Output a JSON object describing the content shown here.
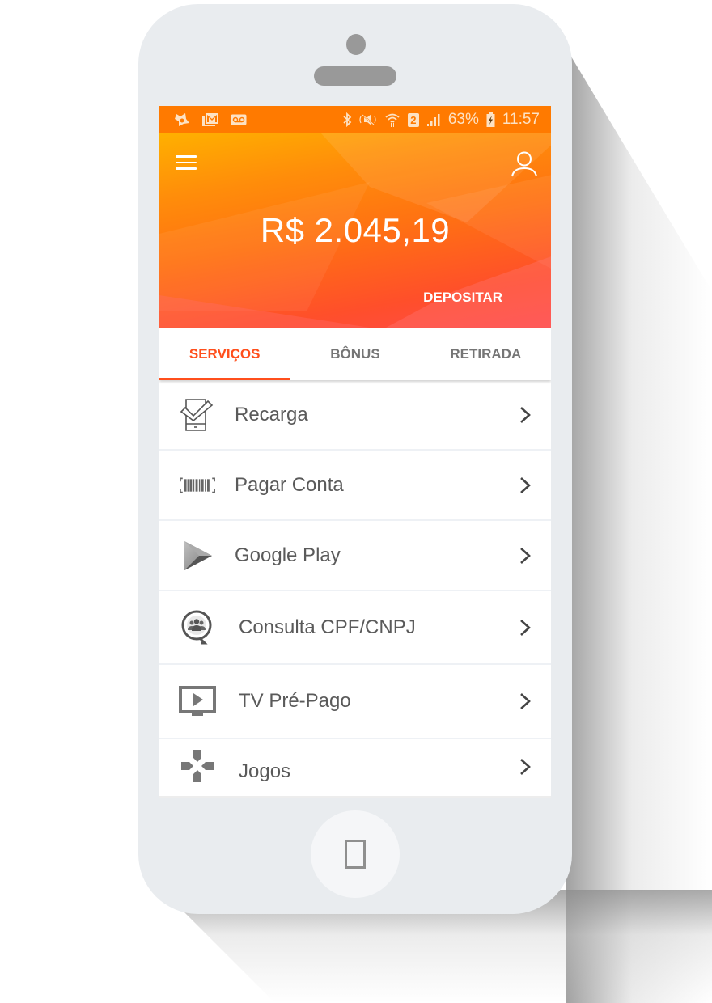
{
  "status_bar": {
    "left_icons": [
      "avast-icon",
      "gmail-icon",
      "voicemail-icon"
    ],
    "right_icons": [
      "bluetooth-icon",
      "mute-icon",
      "wifi-icon",
      "sim-icon",
      "signal-icon"
    ],
    "sim_slot": "2",
    "battery": "63%",
    "time": "11:57"
  },
  "header": {
    "balance": "R$ 2.045,19",
    "deposit_label": "DEPOSITAR"
  },
  "tabs": [
    {
      "label": "SERVIÇOS",
      "active": true
    },
    {
      "label": "BÔNUS",
      "active": false
    },
    {
      "label": "RETIRADA",
      "active": false
    }
  ],
  "services": [
    {
      "label": "Recarga",
      "icon": "phone-check-icon"
    },
    {
      "label": "Pagar Conta",
      "icon": "barcode-icon"
    },
    {
      "label": "Google Play",
      "icon": "google-play-icon"
    },
    {
      "label": "Consulta CPF/CNPJ",
      "icon": "people-search-icon"
    },
    {
      "label": "TV Pré-Pago",
      "icon": "tv-play-icon"
    },
    {
      "label": "Jogos",
      "icon": "gamepad-icon"
    }
  ],
  "colors": {
    "status_bar": "#ff7a00",
    "accent": "#ff4f1c",
    "tab_inactive": "#757575",
    "phone_body": "#e9ecef"
  }
}
